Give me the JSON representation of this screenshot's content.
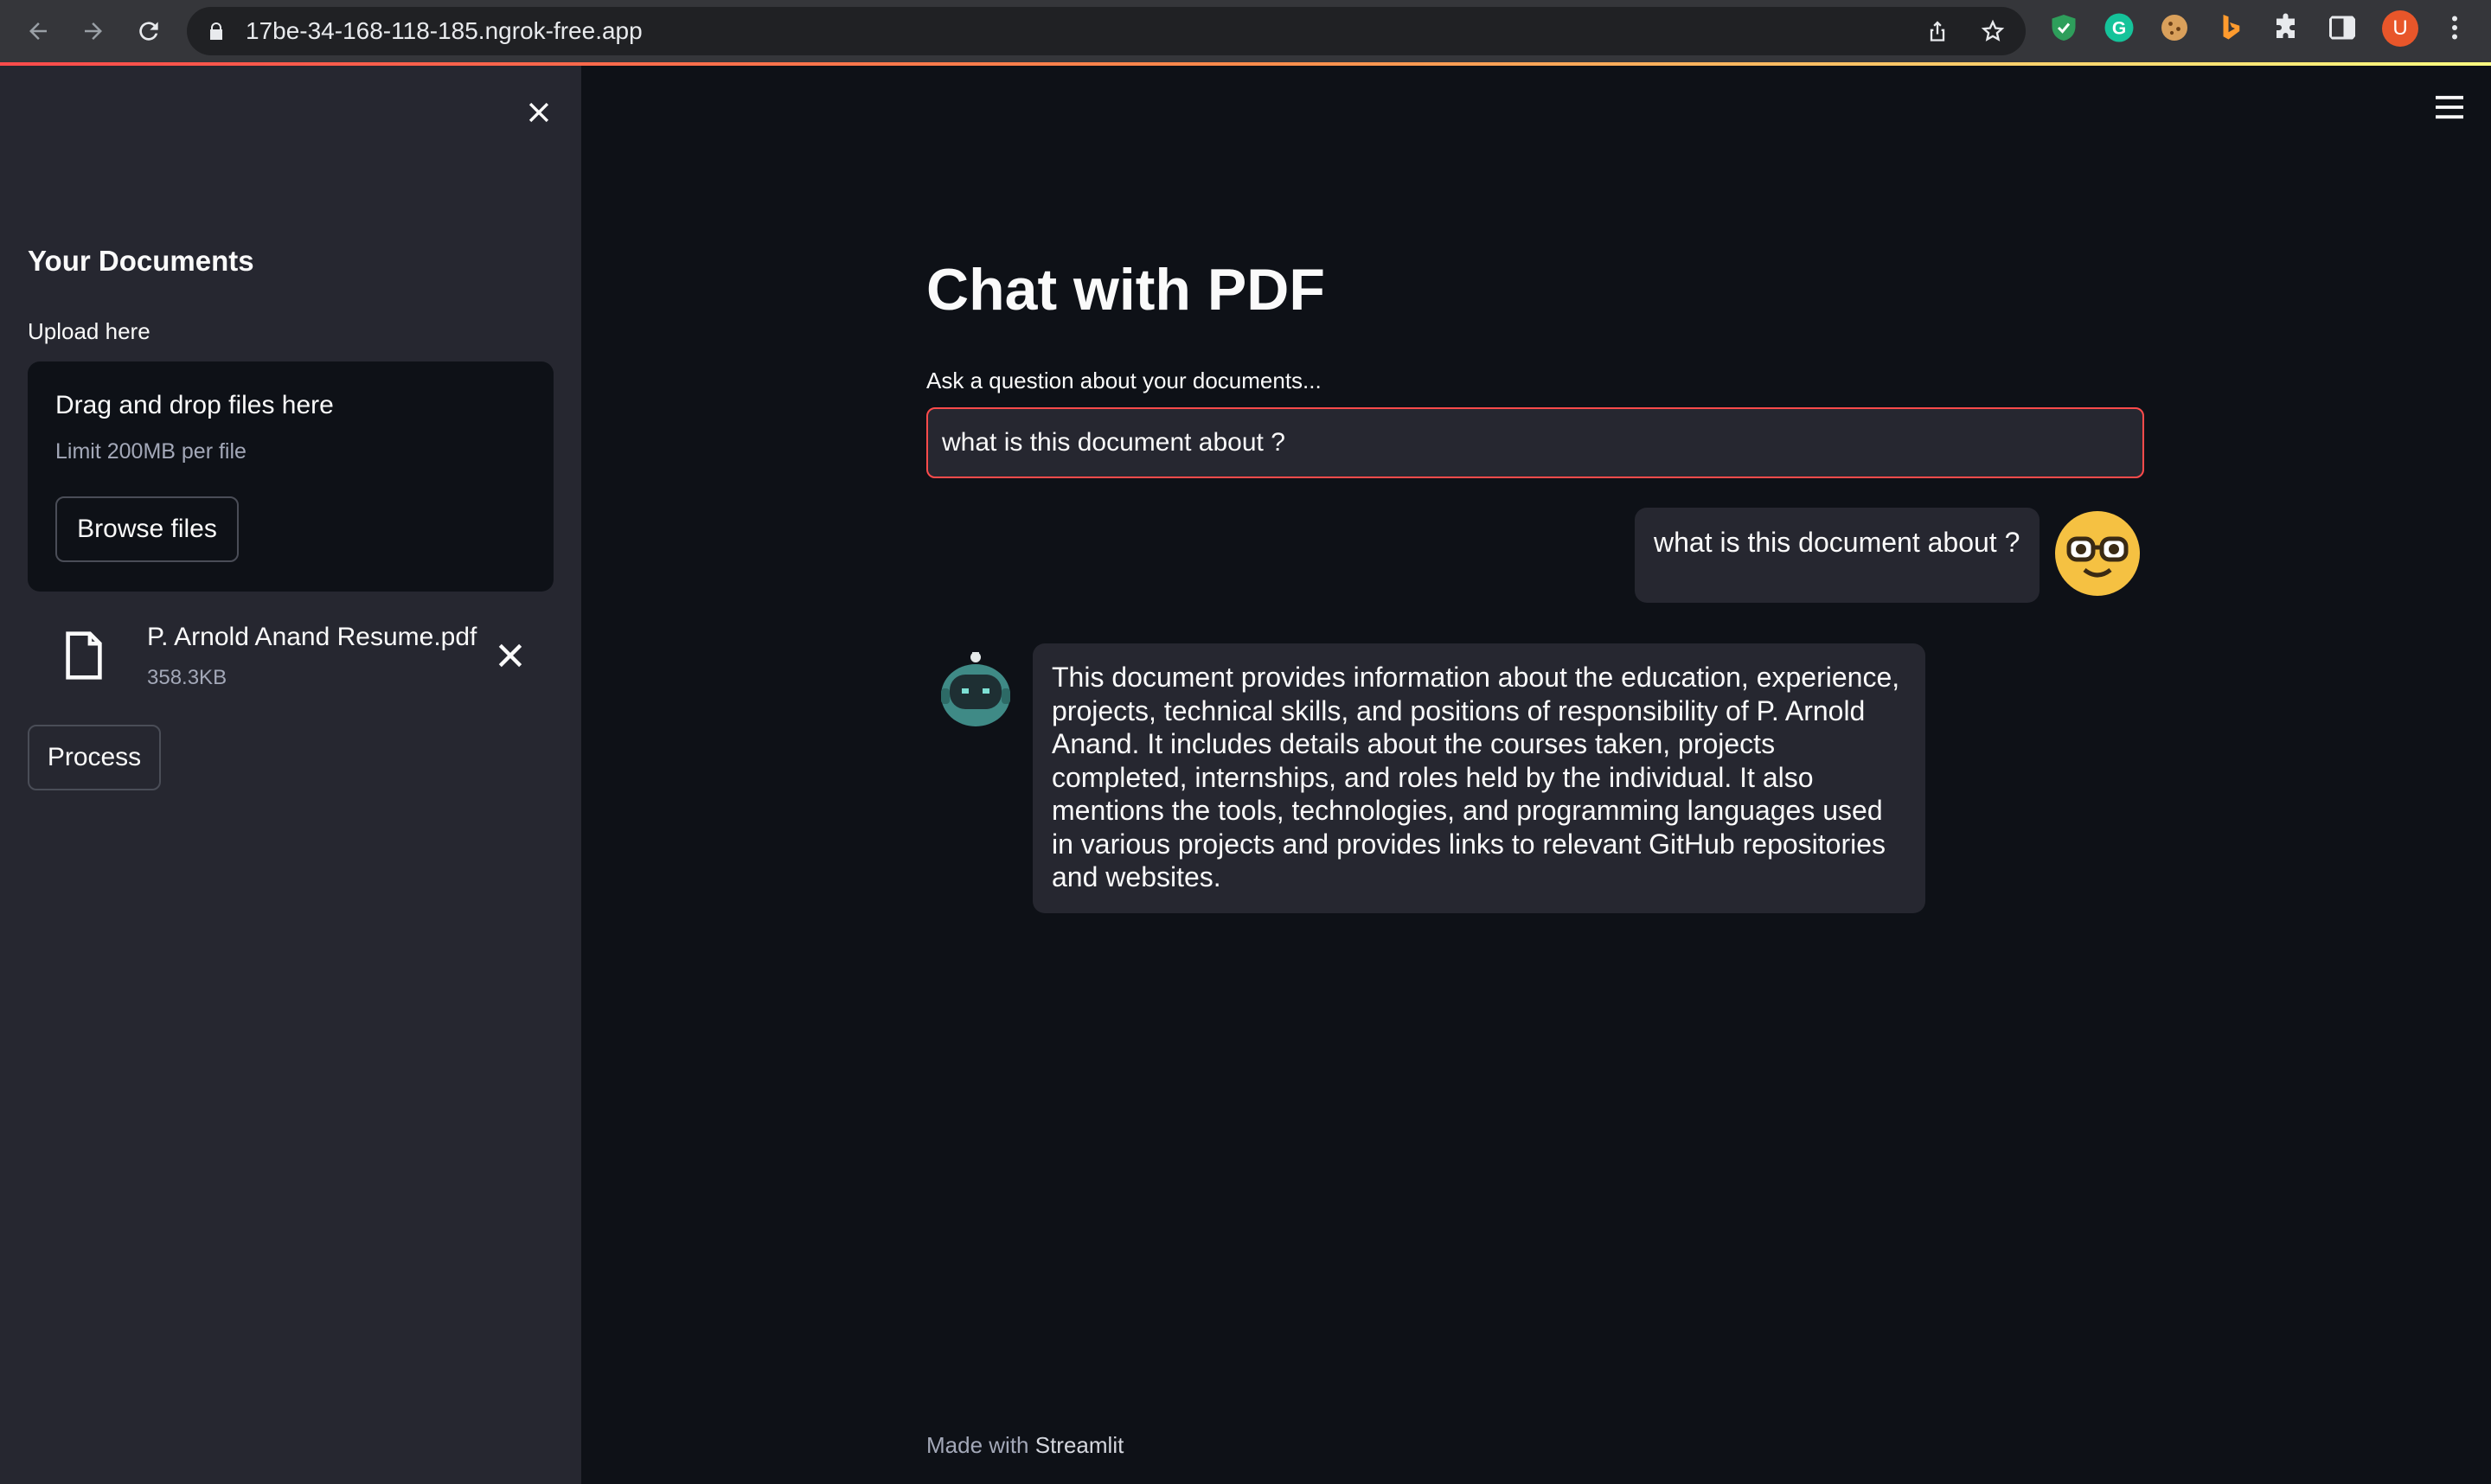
{
  "browser": {
    "url": "17be-34-168-118-185.ngrok-free.app",
    "profile_initial": "U",
    "extensions": [
      "shield-check-icon",
      "grammarly-icon",
      "cookie-icon",
      "bing-icon",
      "puzzle-icon"
    ]
  },
  "sidebar": {
    "title": "Your Documents",
    "upload_label": "Upload here",
    "dropzone": {
      "title": "Drag and drop files here",
      "limit": "Limit 200MB per file",
      "browse_label": "Browse files"
    },
    "file": {
      "name": "P. Arnold Anand Resume.pdf",
      "size": "358.3KB"
    },
    "process_label": "Process"
  },
  "main": {
    "title": "Chat with PDF",
    "question_label": "Ask a question about your documents...",
    "question_value": "what is this document about ?",
    "messages": [
      {
        "role": "user",
        "text": "what is this document about ?"
      },
      {
        "role": "bot",
        "text": "This document provides information about the education, experience, projects, technical skills, and positions of responsibility of P. Arnold Anand. It includes details about the courses taken, projects completed, internships, and roles held by the individual. It also mentions the tools, technologies, and programming languages used in various projects and provides links to relevant GitHub repositories and websites."
      }
    ],
    "footer_prefix": "Made with",
    "footer_brand": "Streamlit"
  },
  "colors": {
    "background": "#0e1117",
    "sidebar": "#262730",
    "accent": "#ff4b4b",
    "user_avatar": "#f5c142",
    "bot_avatar": "#3f8a86"
  }
}
